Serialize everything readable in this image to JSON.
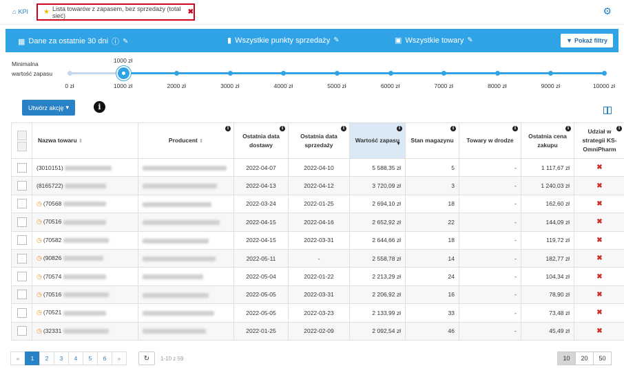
{
  "breadcrumb": {
    "home_label": "KPI",
    "active_tab": "Lista towarów z zapasem, bez sprzedaży (total sieć)"
  },
  "filters": {
    "period": "Dane za ostatnie 30 dni",
    "points": "Wszystkie punkty sprzedaży",
    "products": "Wszystkie towary",
    "show_filters": "Pokaż filtry"
  },
  "slider": {
    "label": "Minimalna wartość zapasu",
    "current": "1000 zł",
    "current_value": 1000,
    "ticks": [
      "0 zł",
      "1000 zł",
      "2000 zł",
      "3000 zł",
      "4000 zł",
      "5000 zł",
      "6000 zł",
      "7000 zł",
      "8000 zł",
      "9000 zł",
      "10000 zł"
    ]
  },
  "actions": {
    "create_action": "Utwórz akcję"
  },
  "table": {
    "headers": {
      "name": "Nazwa towaru",
      "producer": "Producent",
      "last_delivery": "Ostatnia data dostawy",
      "last_sale": "Ostatnia data sprzedaży",
      "stock_value": "Wartość zapasu",
      "stock_qty": "Stan magazynu",
      "in_transit": "Towary w drodze",
      "last_price": "Ostatnia cena zakupu",
      "strategy": "Udział w strategii KS-OmniPharm"
    },
    "rows": [
      {
        "code": "(3010151)",
        "clock": false,
        "delivery": "2022-04-07",
        "sale": "2022-04-10",
        "value": "5 588,35 zł",
        "qty": "5",
        "transit": "-",
        "price": "1 117,67 zł"
      },
      {
        "code": "(8165722)",
        "clock": false,
        "delivery": "2022-04-13",
        "sale": "2022-04-12",
        "value": "3 720,09 zł",
        "qty": "3",
        "transit": "-",
        "price": "1 240,03 zł"
      },
      {
        "code": "(70568",
        "clock": true,
        "delivery": "2022-03-24",
        "sale": "2022-01-25",
        "value": "2 694,10 zł",
        "qty": "18",
        "transit": "-",
        "price": "162,60 zł"
      },
      {
        "code": "(70516",
        "clock": true,
        "delivery": "2022-04-15",
        "sale": "2022-04-16",
        "value": "2 652,92 zł",
        "qty": "22",
        "transit": "-",
        "price": "144,09 zł"
      },
      {
        "code": "(70582",
        "clock": true,
        "delivery": "2022-04-15",
        "sale": "2022-03-31",
        "value": "2 644,66 zł",
        "qty": "18",
        "transit": "-",
        "price": "119,72 zł"
      },
      {
        "code": "(90826",
        "clock": true,
        "delivery": "2022-05-11",
        "sale": "-",
        "value": "2 558,78 zł",
        "qty": "14",
        "transit": "-",
        "price": "182,77 zł"
      },
      {
        "code": "(70574",
        "clock": true,
        "delivery": "2022-05-04",
        "sale": "2022-01-22",
        "value": "2 213,29 zł",
        "qty": "24",
        "transit": "-",
        "price": "104,34 zł"
      },
      {
        "code": "(70516",
        "clock": true,
        "delivery": "2022-05-05",
        "sale": "2022-03-31",
        "value": "2 206,92 zł",
        "qty": "16",
        "transit": "-",
        "price": "78,90 zł"
      },
      {
        "code": "(70521",
        "clock": true,
        "delivery": "2022-05-05",
        "sale": "2022-03-23",
        "value": "2 133,99 zł",
        "qty": "33",
        "transit": "-",
        "price": "73,48 zł"
      },
      {
        "code": "(32331",
        "clock": true,
        "delivery": "2022-01-25",
        "sale": "2022-02-09",
        "value": "2 092,54 zł",
        "qty": "46",
        "transit": "-",
        "price": "45,49 zł"
      }
    ]
  },
  "pagination": {
    "prev": "«",
    "pages": [
      "1",
      "2",
      "3",
      "4",
      "5",
      "6"
    ],
    "next": "»",
    "current": "1",
    "range": "1-10 z 59",
    "page_sizes": [
      "10",
      "20",
      "50"
    ],
    "current_size": "10"
  },
  "colors": {
    "accent": "#2fa3e6",
    "button": "#2a82c6",
    "highlight_border": "#d0021b",
    "sorted_column": "#dbe9f6",
    "clock": "#f08a1c",
    "cross": "#c9302c"
  }
}
